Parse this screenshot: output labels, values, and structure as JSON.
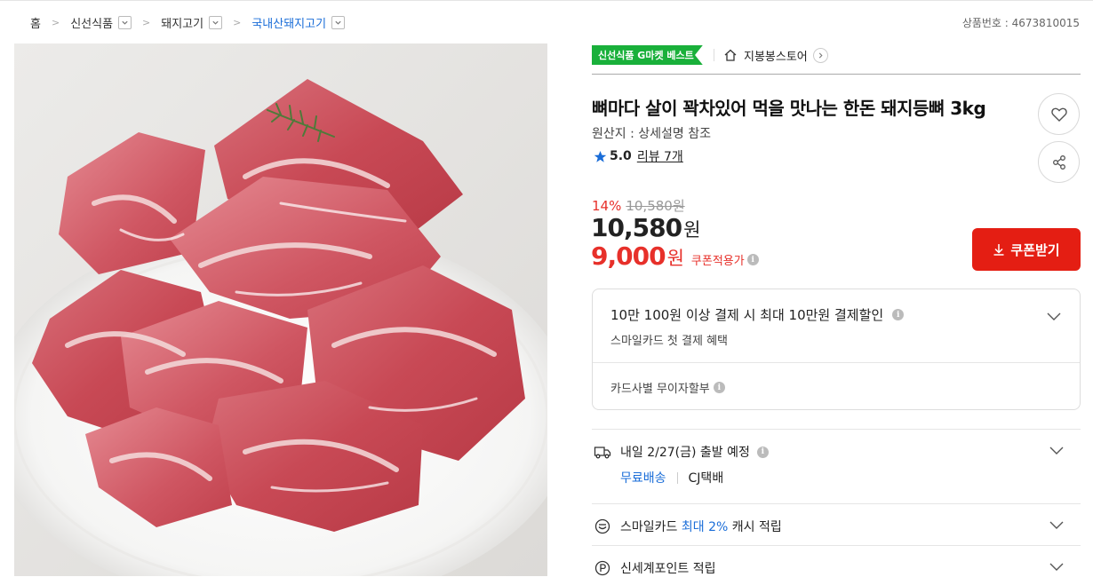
{
  "breadcrumb": {
    "items": [
      {
        "label": "홈"
      },
      {
        "label": "신선식품"
      },
      {
        "label": "돼지고기"
      },
      {
        "label": "국내산돼지고기"
      }
    ]
  },
  "product_no": "상품번호 : 4673810015",
  "badge": "신선식품 G마켓 베스트",
  "store_name": "지봉봉스토어",
  "title": "뼈마다 살이 꽉차있어 먹을 맛나는 한돈 돼지등뼈 3kg",
  "origin": "원산지 : 상세설명 참조",
  "rating": {
    "score": "5.0",
    "review": "리뷰 7개"
  },
  "price": {
    "discount_rate": "14%",
    "original": "10,580원",
    "current_number": "10,580",
    "current_unit": "원",
    "coupon_number": "9,000",
    "coupon_unit": "원",
    "coupon_note": "쿠폰적용가"
  },
  "coupon_button": "쿠폰받기",
  "card_promo": {
    "title": "10만 100원 이상 결제 시 최대 10만원 결제할인",
    "sub": "스마일카드 첫 결제 혜택",
    "installment": "카드사별 무이자할부"
  },
  "shipping": {
    "text": "내일 2/27(금) 출발 예정",
    "free": "무료배송",
    "carrier": "CJ택배"
  },
  "smile_cash": {
    "prefix": "스마일카드",
    "highlight": "최대 2%",
    "suffix": "캐시 적립"
  },
  "points": "신세계포인트 적립",
  "colors": {
    "accent_red": "#e41e13",
    "link_blue": "#1a6dd8",
    "badge_green": "#19b03a"
  },
  "icons": [
    "chevron-down-icon",
    "home-icon",
    "chevron-right-icon",
    "star-icon",
    "heart-icon",
    "share-icon",
    "download-icon",
    "info-icon",
    "truck-icon",
    "smile-icon",
    "p-circle-icon"
  ]
}
